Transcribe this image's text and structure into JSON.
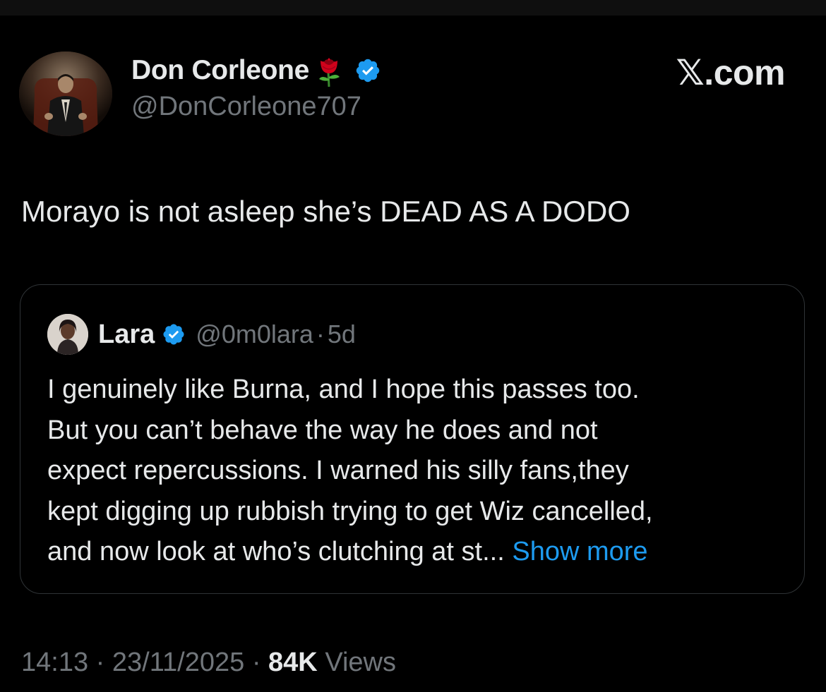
{
  "author": {
    "display_name": "Don Corleone",
    "handle": "@DonCorleone707",
    "emoji_icon": "rose-icon",
    "verified_color": "#1d9bf0"
  },
  "brand": "𝕏.com",
  "tweet": {
    "text": "Morayo is not asleep she’s DEAD AS A DODO"
  },
  "quoted": {
    "name": "Lara",
    "handle": "@0m0lara",
    "separator": "·",
    "time": "5d",
    "lines": [
      "I genuinely like Burna, and I hope this passes too.",
      "But you can’t behave the way he does and not",
      "expect repercussions. I warned his silly fans,they",
      "kept digging up rubbish trying to get Wiz cancelled,",
      "and now look at who’s clutching at st..."
    ],
    "show_more": "Show more"
  },
  "meta": {
    "time": "14:13",
    "sep1": "·",
    "date": "23/11/2025",
    "sep2": "·",
    "views_count": "84K",
    "views_label": "Views"
  },
  "colors": {
    "background": "#000000",
    "text": "#e7e9ea",
    "muted": "#71767b",
    "link": "#1d9bf0",
    "border": "#2f3336"
  }
}
